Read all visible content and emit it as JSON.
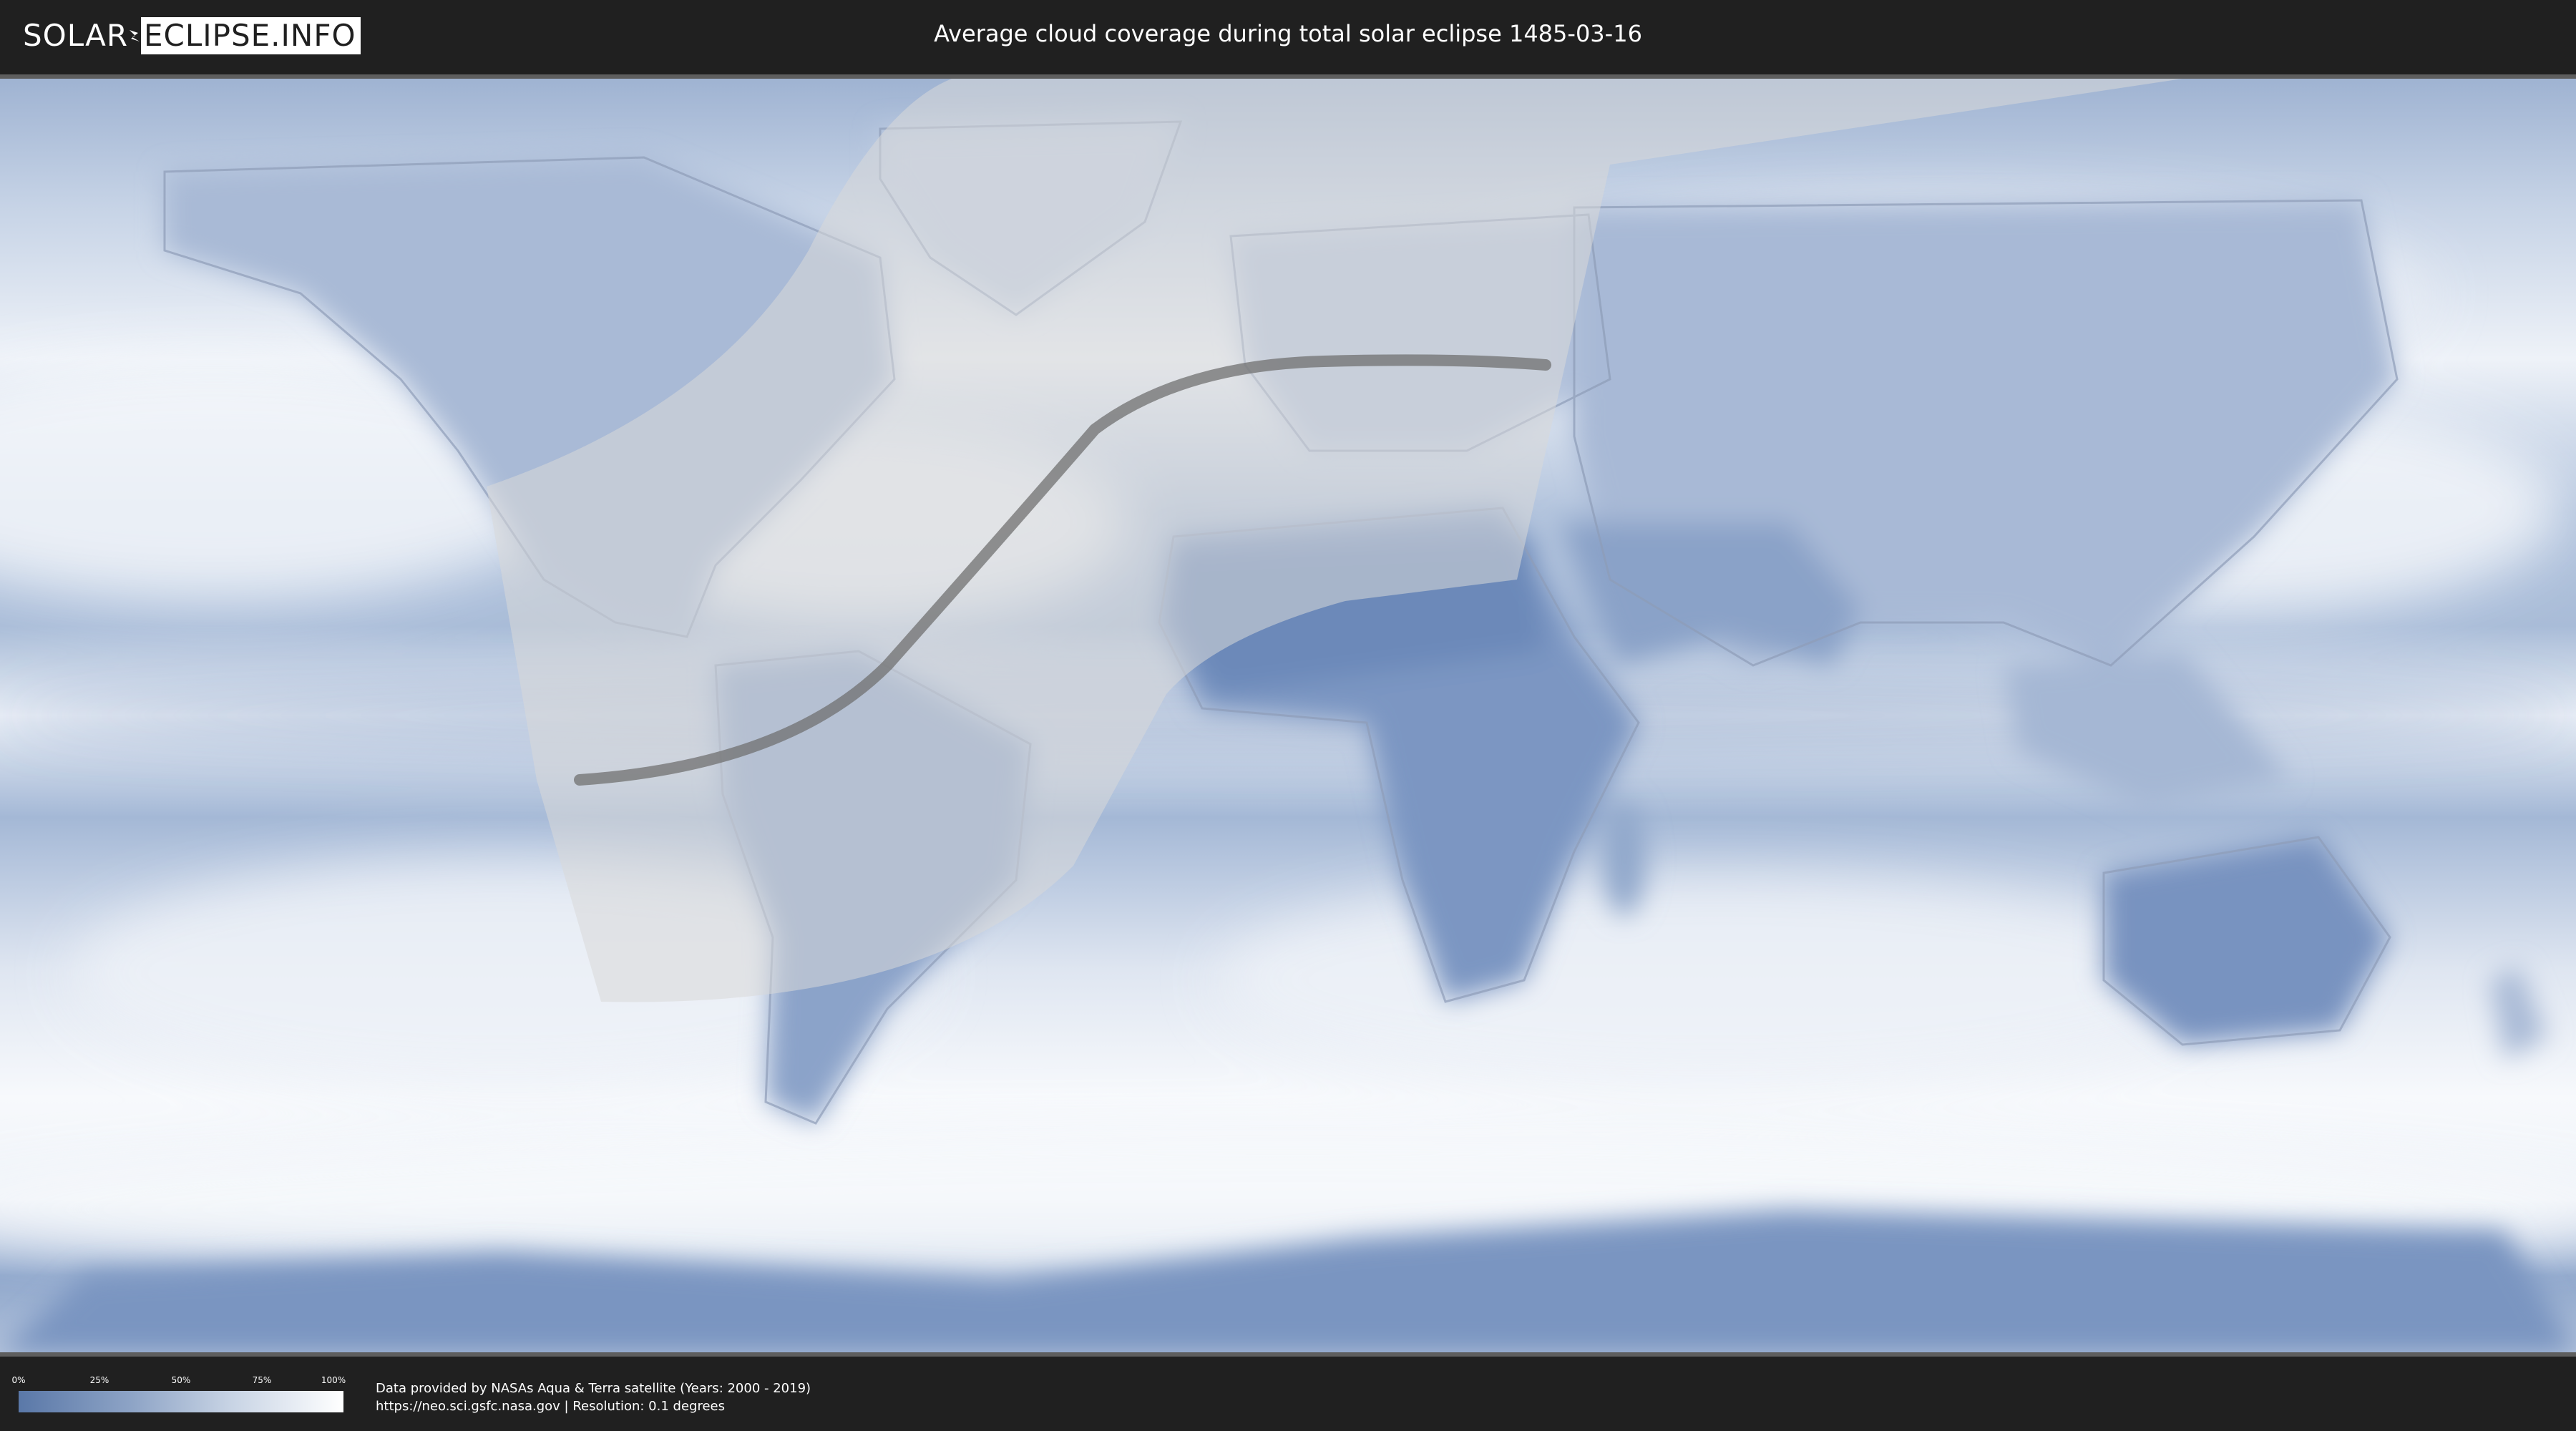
{
  "header": {
    "logo_left": "SOLAR",
    "logo_right": "ECLIPSE.INFO",
    "title": "Average cloud coverage during total solar eclipse 1485-03-16"
  },
  "legend": {
    "ticks": [
      "0%",
      "25%",
      "50%",
      "75%",
      "100%"
    ],
    "colors": [
      "#5a78a8",
      "#8ea4c6",
      "#c7d3e4",
      "#ffffff"
    ]
  },
  "credits": {
    "line1": "Data provided by NASAs Aqua & Terra satellite (Years: 2000 - 2019)",
    "line2": "https://neo.sci.gsfc.nasa.gov | Resolution: 0.1 degrees"
  },
  "map_colors": {
    "ocean_clear": "#6f8dba",
    "cloud": "#f2f5fa",
    "land": "#7590be",
    "coast": "#9aa9c2",
    "eclipse_band": "#d8d8d8",
    "central_line": "#707070"
  }
}
